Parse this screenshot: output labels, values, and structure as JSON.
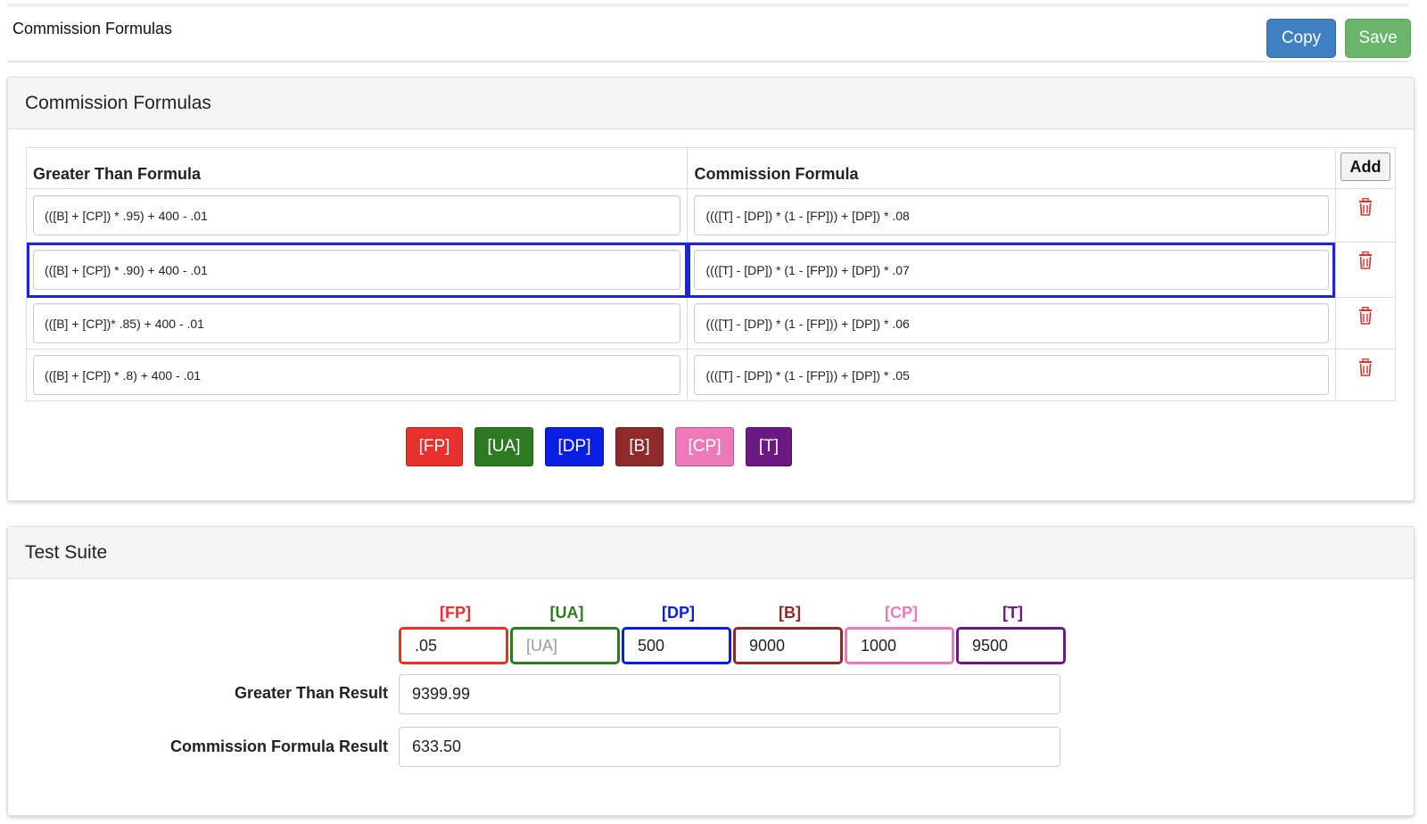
{
  "header": {
    "title": "Commission Formulas",
    "copy_label": "Copy",
    "save_label": "Save"
  },
  "formulas_panel": {
    "title": "Commission Formulas",
    "columns": {
      "greater_than": "Greater Than Formula",
      "commission": "Commission Formula",
      "add_label": "Add"
    },
    "rows": [
      {
        "greater_than": "(([B] + [CP]) * .95) + 400 - .01",
        "commission": "((([T] - [DP]) * (1 - [FP])) + [DP]) * .08",
        "selected": false
      },
      {
        "greater_than": "(([B] + [CP]) * .90) + 400 - .01",
        "commission": "((([T] - [DP]) * (1 - [FP])) + [DP]) * .07",
        "selected": true
      },
      {
        "greater_than": "(([B] + [CP])* .85) + 400 - .01",
        "commission": "((([T] - [DP]) * (1 - [FP])) + [DP]) * .06",
        "selected": false
      },
      {
        "greater_than": "(([B] + [CP]) * .8) + 400 - .01",
        "commission": "((([T] - [DP]) * (1 - [FP])) + [DP]) * .05",
        "selected": false
      }
    ],
    "tokens": [
      {
        "label": "[FP]",
        "color": "#e8312a"
      },
      {
        "label": "[UA]",
        "color": "#2e7a22"
      },
      {
        "label": "[DP]",
        "color": "#0a1ee3"
      },
      {
        "label": "[B]",
        "color": "#8f2a2a"
      },
      {
        "label": "[CP]",
        "color": "#ec7ab8"
      },
      {
        "label": "[T]",
        "color": "#6b1a82"
      }
    ]
  },
  "test_panel": {
    "title": "Test Suite",
    "variables": [
      {
        "label": "[FP]",
        "value": ".05",
        "placeholder": "[FP]",
        "color": "#e8312a"
      },
      {
        "label": "[UA]",
        "value": "",
        "placeholder": "[UA]",
        "color": "#2e7a22"
      },
      {
        "label": "[DP]",
        "value": "500",
        "placeholder": "[DP]",
        "color": "#0a1ee3"
      },
      {
        "label": "[B]",
        "value": "9000",
        "placeholder": "[B]",
        "color": "#8f2a2a"
      },
      {
        "label": "[CP]",
        "value": "1000",
        "placeholder": "[CP]",
        "color": "#ec7ab8"
      },
      {
        "label": "[T]",
        "value": "9500",
        "placeholder": "[T]",
        "color": "#6b1a82"
      }
    ],
    "greater_than_result_label": "Greater Than Result",
    "greater_than_result": "9399.99",
    "commission_result_label": "Commission Formula Result",
    "commission_result": "633.50"
  }
}
